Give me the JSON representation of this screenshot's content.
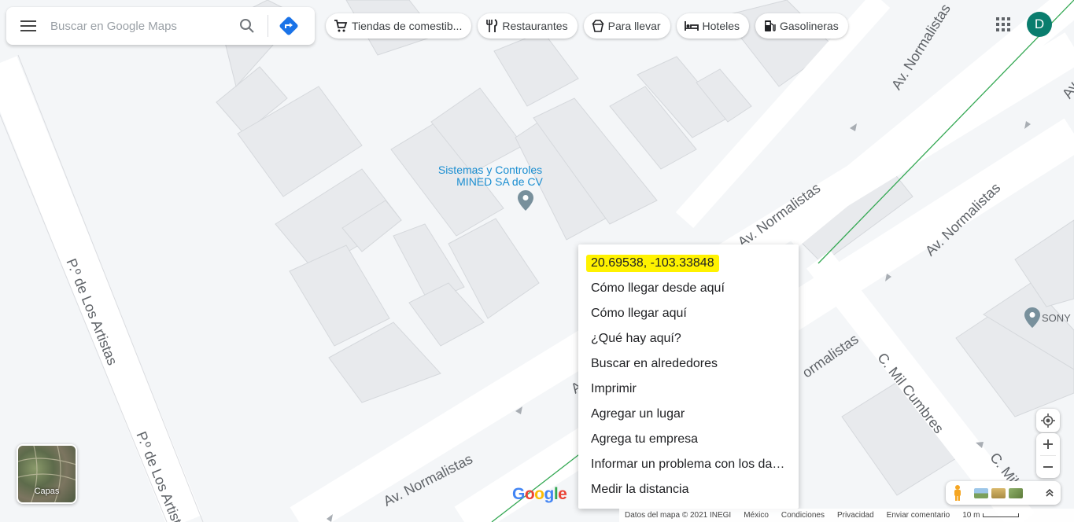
{
  "search": {
    "placeholder": "Buscar en Google Maps"
  },
  "chips": [
    {
      "label": "Tiendas de comestib...",
      "icon": "cart-icon"
    },
    {
      "label": "Restaurantes",
      "icon": "fork-knife-icon"
    },
    {
      "label": "Para llevar",
      "icon": "takeout-icon"
    },
    {
      "label": "Hoteles",
      "icon": "bed-icon"
    },
    {
      "label": "Gasolineras",
      "icon": "gas-pump-icon"
    }
  ],
  "account": {
    "initial": "D",
    "color": "#0a7d6e"
  },
  "map": {
    "streets": {
      "artistas_top": "P.º de Los Artistas",
      "artistas_bottom": "P.º de Los Artistas",
      "normalistas_1": "Av. Normalistas",
      "normalistas_2": "Av. Normalistas",
      "normalistas_3": "Av. Normalistas",
      "normalistas_4": "Av. Normalistas",
      "normalistas_5": "ormalistas",
      "normalistas_6": "Av",
      "normalistas_7": "Av",
      "mil_cumbres_1": "C. Mil Cumbres",
      "mil_cumbres_2": "C. Mil C"
    },
    "pois": {
      "mined_line1": "Sistemas y Controles",
      "mined_line2": "MINED SA de CV",
      "sony": "SONY"
    }
  },
  "context_menu": {
    "coordinates": "20.69538, -103.33848",
    "items": [
      "Cómo llegar desde aquí",
      "Cómo llegar aquí",
      "¿Qué hay aquí?",
      "Buscar en alrededores",
      "Imprimir",
      "Agregar un lugar",
      "Agrega tu empresa",
      "Informar un problema con los datos",
      "Medir la distancia"
    ]
  },
  "layers": {
    "label": "Capas"
  },
  "logo": {
    "text": "Google"
  },
  "footer": {
    "map_data": "Datos del mapa © 2021 INEGI",
    "country": "México",
    "terms": "Condiciones",
    "privacy": "Privacidad",
    "feedback": "Enviar comentario",
    "scale": "10 m"
  },
  "colors": {
    "accent": "#1a73e8",
    "highlight": "#fff200",
    "route_green": "#34a853",
    "poi_blue": "#1a8ed1"
  }
}
